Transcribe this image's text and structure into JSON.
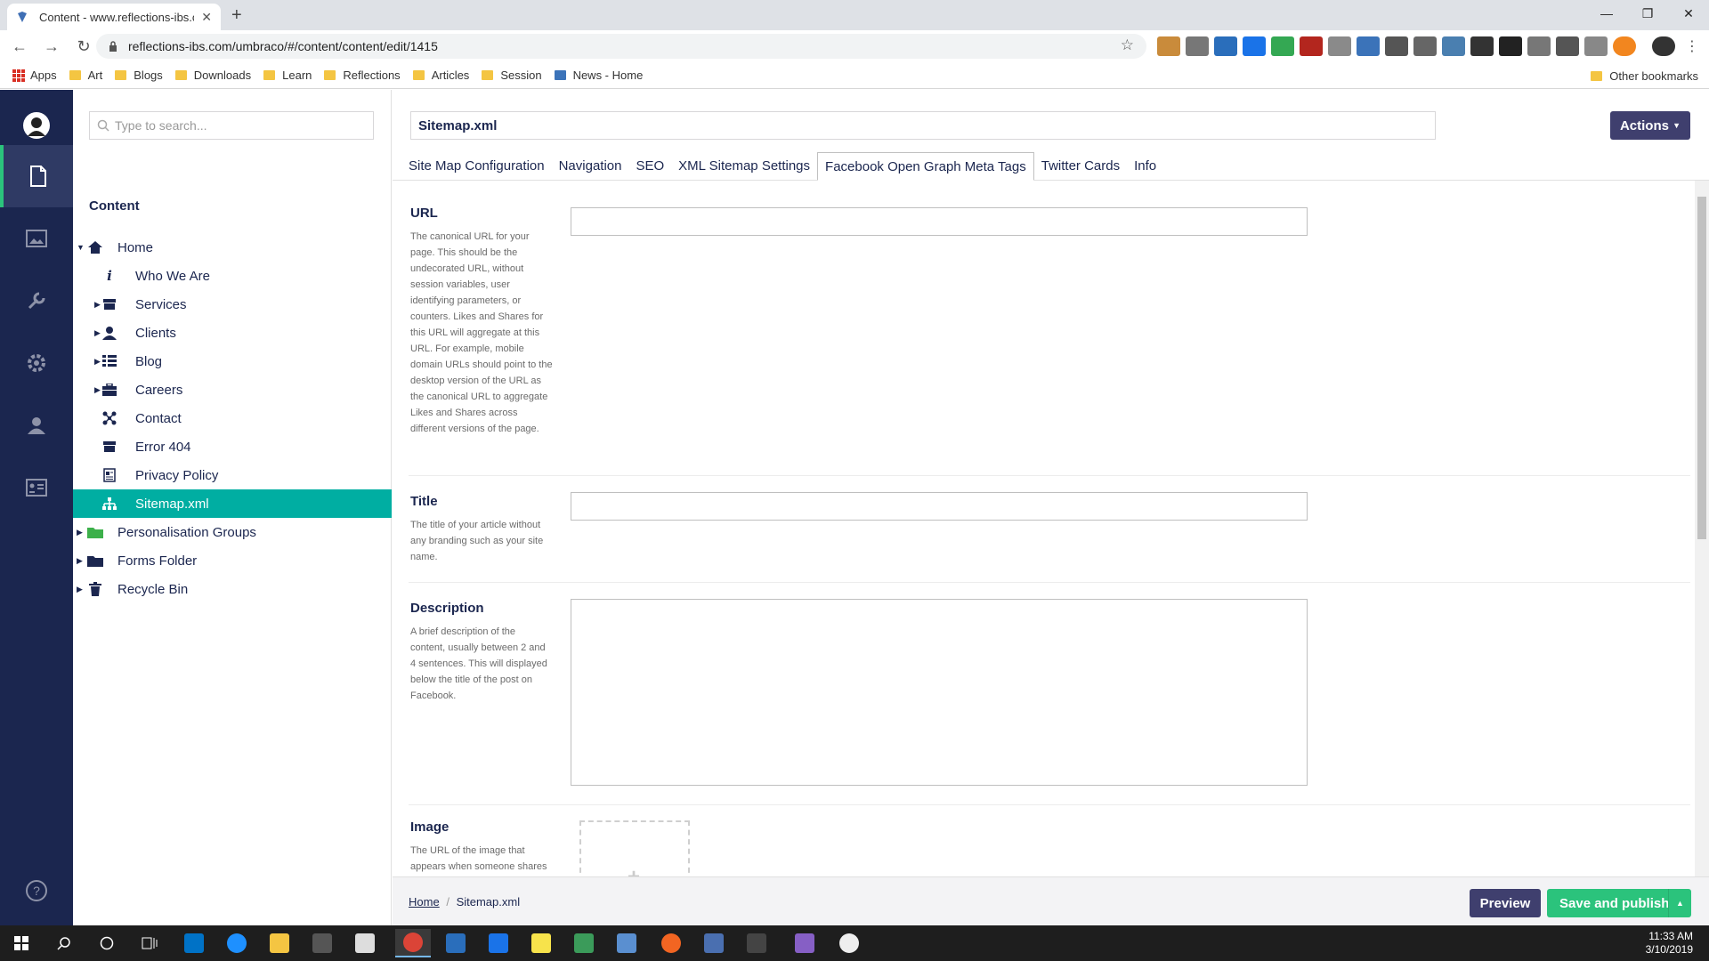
{
  "browser": {
    "tab_title": "Content - www.reflections-ibs.co",
    "url": "reflections-ibs.com/umbraco/#/content/content/edit/1415",
    "bookmarks": [
      "Apps",
      "Art",
      "Blogs",
      "Downloads",
      "Learn",
      "Reflections",
      "Articles",
      "Session",
      "News - Home"
    ],
    "other_bookmarks": "Other bookmarks"
  },
  "tree": {
    "search_placeholder": "Type to search...",
    "title": "Content",
    "nodes": [
      {
        "label": "Home",
        "icon": "home-icon"
      },
      {
        "label": "Who We Are",
        "icon": "info-icon"
      },
      {
        "label": "Services",
        "icon": "box-icon"
      },
      {
        "label": "Clients",
        "icon": "user-icon"
      },
      {
        "label": "Blog",
        "icon": "list-icon"
      },
      {
        "label": "Careers",
        "icon": "briefcase-icon"
      },
      {
        "label": "Contact",
        "icon": "network-icon"
      },
      {
        "label": "Error 404",
        "icon": "box-icon"
      },
      {
        "label": "Privacy Policy",
        "icon": "document-icon"
      },
      {
        "label": "Sitemap.xml",
        "icon": "sitemap-icon"
      },
      {
        "label": "Personalisation Groups",
        "icon": "green-folder-icon"
      },
      {
        "label": "Forms Folder",
        "icon": "folder-icon"
      },
      {
        "label": "Recycle Bin",
        "icon": "trash-icon"
      }
    ]
  },
  "editor": {
    "document_name": "Sitemap.xml",
    "actions_label": "Actions",
    "tabs": [
      "Site Map Configuration",
      "Navigation",
      "SEO",
      "XML Sitemap Settings",
      "Facebook Open Graph Meta Tags",
      "Twitter Cards",
      "Info"
    ],
    "active_tab": "Facebook Open Graph Meta Tags",
    "properties": [
      {
        "label": "URL",
        "description": "The canonical URL for your page. This should be the undecorated URL, without session variables, user identifying parameters, or counters. Likes and Shares for this URL will aggregate at this URL. For example, mobile domain URLs should point to the desktop version of the URL as the canonical URL to aggregate Likes and Shares across different versions of the page.",
        "value": ""
      },
      {
        "label": "Title",
        "description": "The title of your article without any branding such as your site name.",
        "value": ""
      },
      {
        "label": "Description",
        "description": "A brief description of the content, usually between 2 and 4 sentences. This will displayed below the title of the post on Facebook.",
        "value": ""
      },
      {
        "label": "Image",
        "description": "The URL of the image that appears when someone shares the content to",
        "value": ""
      }
    ]
  },
  "footer": {
    "breadcrumb_home": "Home",
    "breadcrumb_sep": "/",
    "breadcrumb_current": "Sitemap.xml",
    "preview_label": "Preview",
    "publish_label": "Save and publish"
  },
  "taskbar": {
    "time": "11:33 AM",
    "date": "3/10/2019"
  },
  "colors": {
    "sidebar": "#1b264f",
    "selected_node": "#00aea2",
    "publish": "#2bc37c",
    "actions": "#3f3f6e"
  }
}
